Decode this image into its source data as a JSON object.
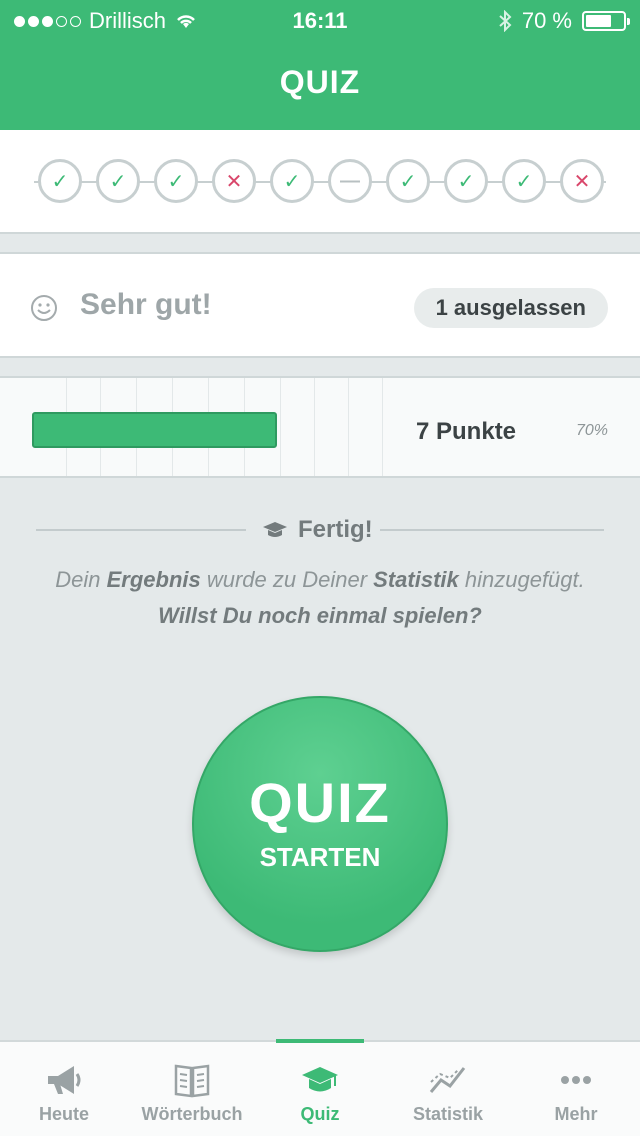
{
  "status_bar": {
    "carrier": "Drillisch",
    "time": "16:11",
    "battery": "70 %",
    "battery_level": 0.7
  },
  "header": {
    "title": "QUIZ"
  },
  "progress": {
    "answers": [
      "correct",
      "correct",
      "correct",
      "wrong",
      "correct",
      "skipped",
      "correct",
      "correct",
      "correct",
      "wrong"
    ]
  },
  "result": {
    "text": "Sehr gut!",
    "skipped_badge": "1 ausgelassen"
  },
  "score": {
    "points": "7 Punkte",
    "percent": "70%",
    "fill_fraction": 0.7
  },
  "finished": {
    "label": "Fertig!",
    "msg_1": "Dein ",
    "msg_ergebnis": "Ergebnis",
    "msg_2": " wurde zu Deiner ",
    "msg_statistik": "Statistik",
    "msg_3": " hinzugefügt.",
    "msg_question": "Willst Du noch einmal spielen?"
  },
  "start_button": {
    "line1": "QUIZ",
    "line2": "STARTEN"
  },
  "tabs": [
    {
      "label": "Heute",
      "icon": "megaphone-icon",
      "active": false
    },
    {
      "label": "Wörterbuch",
      "icon": "book-icon",
      "active": false
    },
    {
      "label": "Quiz",
      "icon": "graduation-cap-icon",
      "active": true
    },
    {
      "label": "Statistik",
      "icon": "chart-icon",
      "active": false
    },
    {
      "label": "Mehr",
      "icon": "more-icon",
      "active": false
    }
  ],
  "colors": {
    "brand": "#3dba76",
    "wrong": "#d9476b"
  }
}
